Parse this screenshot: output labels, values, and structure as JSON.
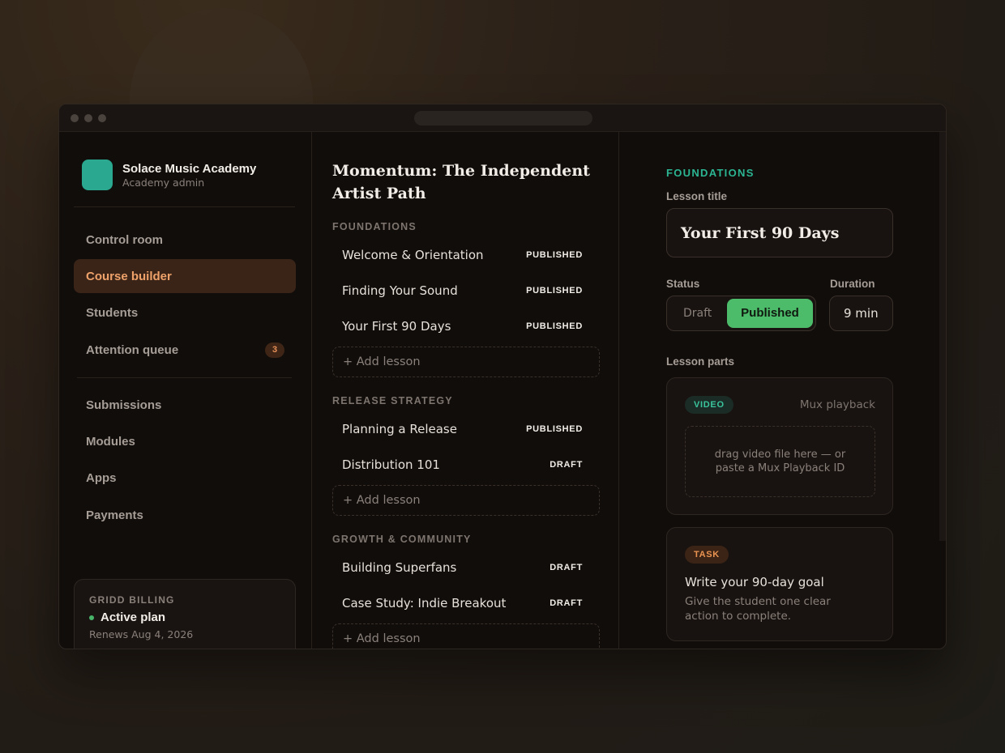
{
  "brand": {
    "name": "Solace Music Academy",
    "role": "Academy admin"
  },
  "nav": {
    "items": [
      {
        "label": "Control room"
      },
      {
        "label": "Course builder"
      },
      {
        "label": "Students"
      },
      {
        "label": "Attention queue",
        "badge": "3"
      },
      {
        "label": "Submissions"
      },
      {
        "label": "Modules"
      },
      {
        "label": "Apps"
      },
      {
        "label": "Payments"
      }
    ],
    "active": "Course builder"
  },
  "billing": {
    "title": "GRIDD BILLING",
    "plan": "Active plan",
    "renews": "Renews Aug 4, 2026"
  },
  "course": {
    "title": "Momentum: The Independent Artist Path",
    "add_lesson_label": "+ Add lesson",
    "sections": [
      {
        "name": "FOUNDATIONS",
        "lessons": [
          {
            "title": "Welcome & Orientation",
            "status": "PUBLISHED"
          },
          {
            "title": "Finding Your Sound",
            "status": "PUBLISHED"
          },
          {
            "title": "Your First 90 Days",
            "status": "PUBLISHED"
          }
        ]
      },
      {
        "name": "RELEASE STRATEGY",
        "lessons": [
          {
            "title": "Planning a Release",
            "status": "PUBLISHED"
          },
          {
            "title": "Distribution 101",
            "status": "DRAFT"
          }
        ]
      },
      {
        "name": "GROWTH & COMMUNITY",
        "lessons": [
          {
            "title": "Building Superfans",
            "status": "DRAFT"
          },
          {
            "title": "Case Study: Indie Breakout",
            "status": "DRAFT"
          }
        ]
      }
    ]
  },
  "editor": {
    "section": "FOUNDATIONS",
    "lesson_title_label": "Lesson title",
    "lesson_title": "Your First 90 Days",
    "status_label": "Status",
    "status_options": [
      "Draft",
      "Published"
    ],
    "status_selected": "Published",
    "duration_label": "Duration",
    "duration": "9 min",
    "parts_label": "Lesson parts",
    "video_part": {
      "tag": "VIDEO",
      "provider": "Mux playback",
      "dropzone": "drag video file here — or paste a Mux Playback ID"
    },
    "task_part": {
      "tag": "TASK",
      "title": "Write your 90-day goal",
      "description": "Give the student one clear action to complete."
    }
  },
  "colors": {
    "accent": "#eea26a",
    "teal": "#2bb592",
    "published_green": "#4cbc6a",
    "logo": "#2aa890"
  }
}
